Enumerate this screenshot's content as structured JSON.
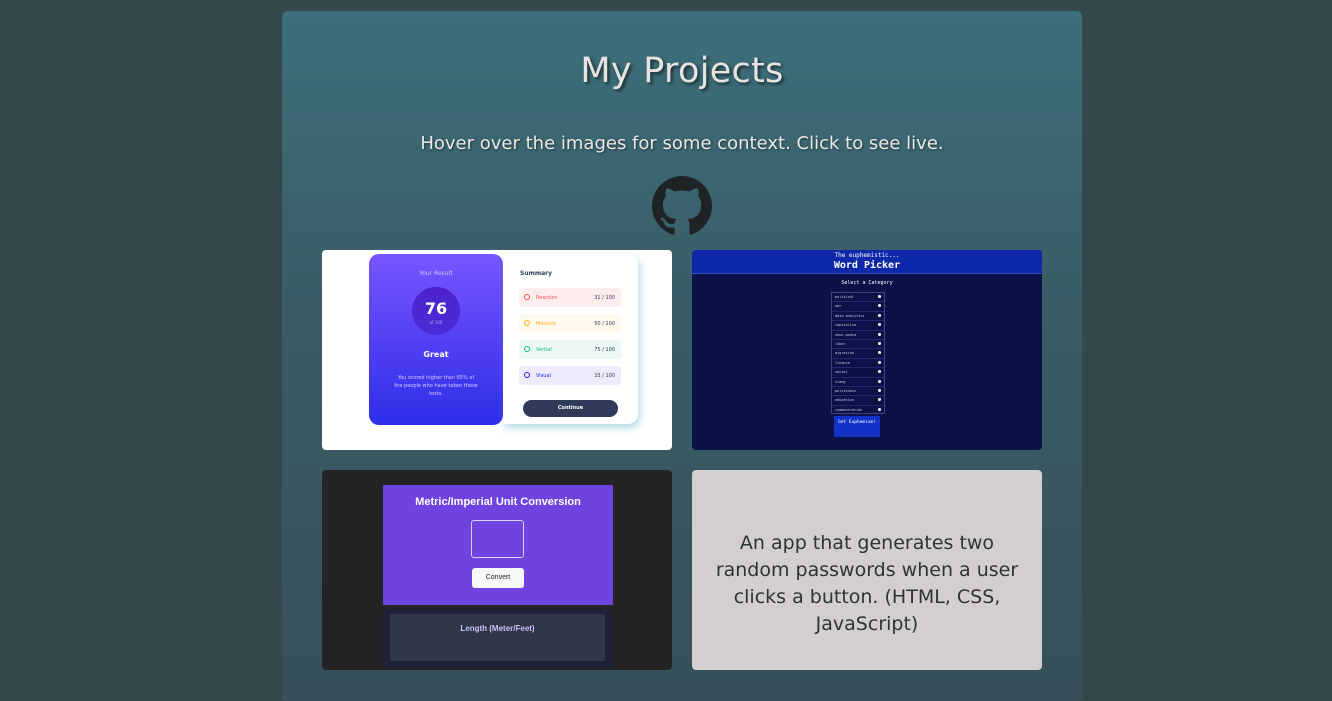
{
  "page": {
    "title": "My Projects",
    "subtitle": "Hover over the images for some context. Click to see live.",
    "github_icon": "github-icon"
  },
  "projects": [
    {
      "name": "results-summary",
      "preview": {
        "your_result": "Your Result",
        "score": "76",
        "of": "of 100",
        "rating": "Great",
        "message": "You scored higher than 65% of the people who have taken these tests.",
        "summary_title": "Summary",
        "rows": [
          {
            "label": "Reaction",
            "value": "31 / 100"
          },
          {
            "label": "Memory",
            "value": "50 / 100"
          },
          {
            "label": "Verbal",
            "value": "75 / 100"
          },
          {
            "label": "Visual",
            "value": "33 / 100"
          }
        ],
        "continue": "Continue"
      }
    },
    {
      "name": "word-picker",
      "preview": {
        "header_small": "The euphemistic...",
        "header_title": "Word Picker",
        "select_label": "Select a Category",
        "categories": [
          "political",
          "war",
          "data analytics",
          "capitalism",
          "news media",
          "labor",
          "migration",
          "finance",
          "social",
          "slang",
          "politeness",
          "education",
          "communication",
          "corporate"
        ],
        "button": "Get Euphemism!"
      }
    },
    {
      "name": "unit-conversion",
      "preview": {
        "title": "Metric/Imperial Unit Conversion",
        "button": "Convert",
        "section": "Length (Meter/Feet)"
      }
    },
    {
      "name": "password-generator",
      "description": "An app that generates two random passwords when a user clicks a button. (HTML, CSS, JavaScript)"
    }
  ]
}
